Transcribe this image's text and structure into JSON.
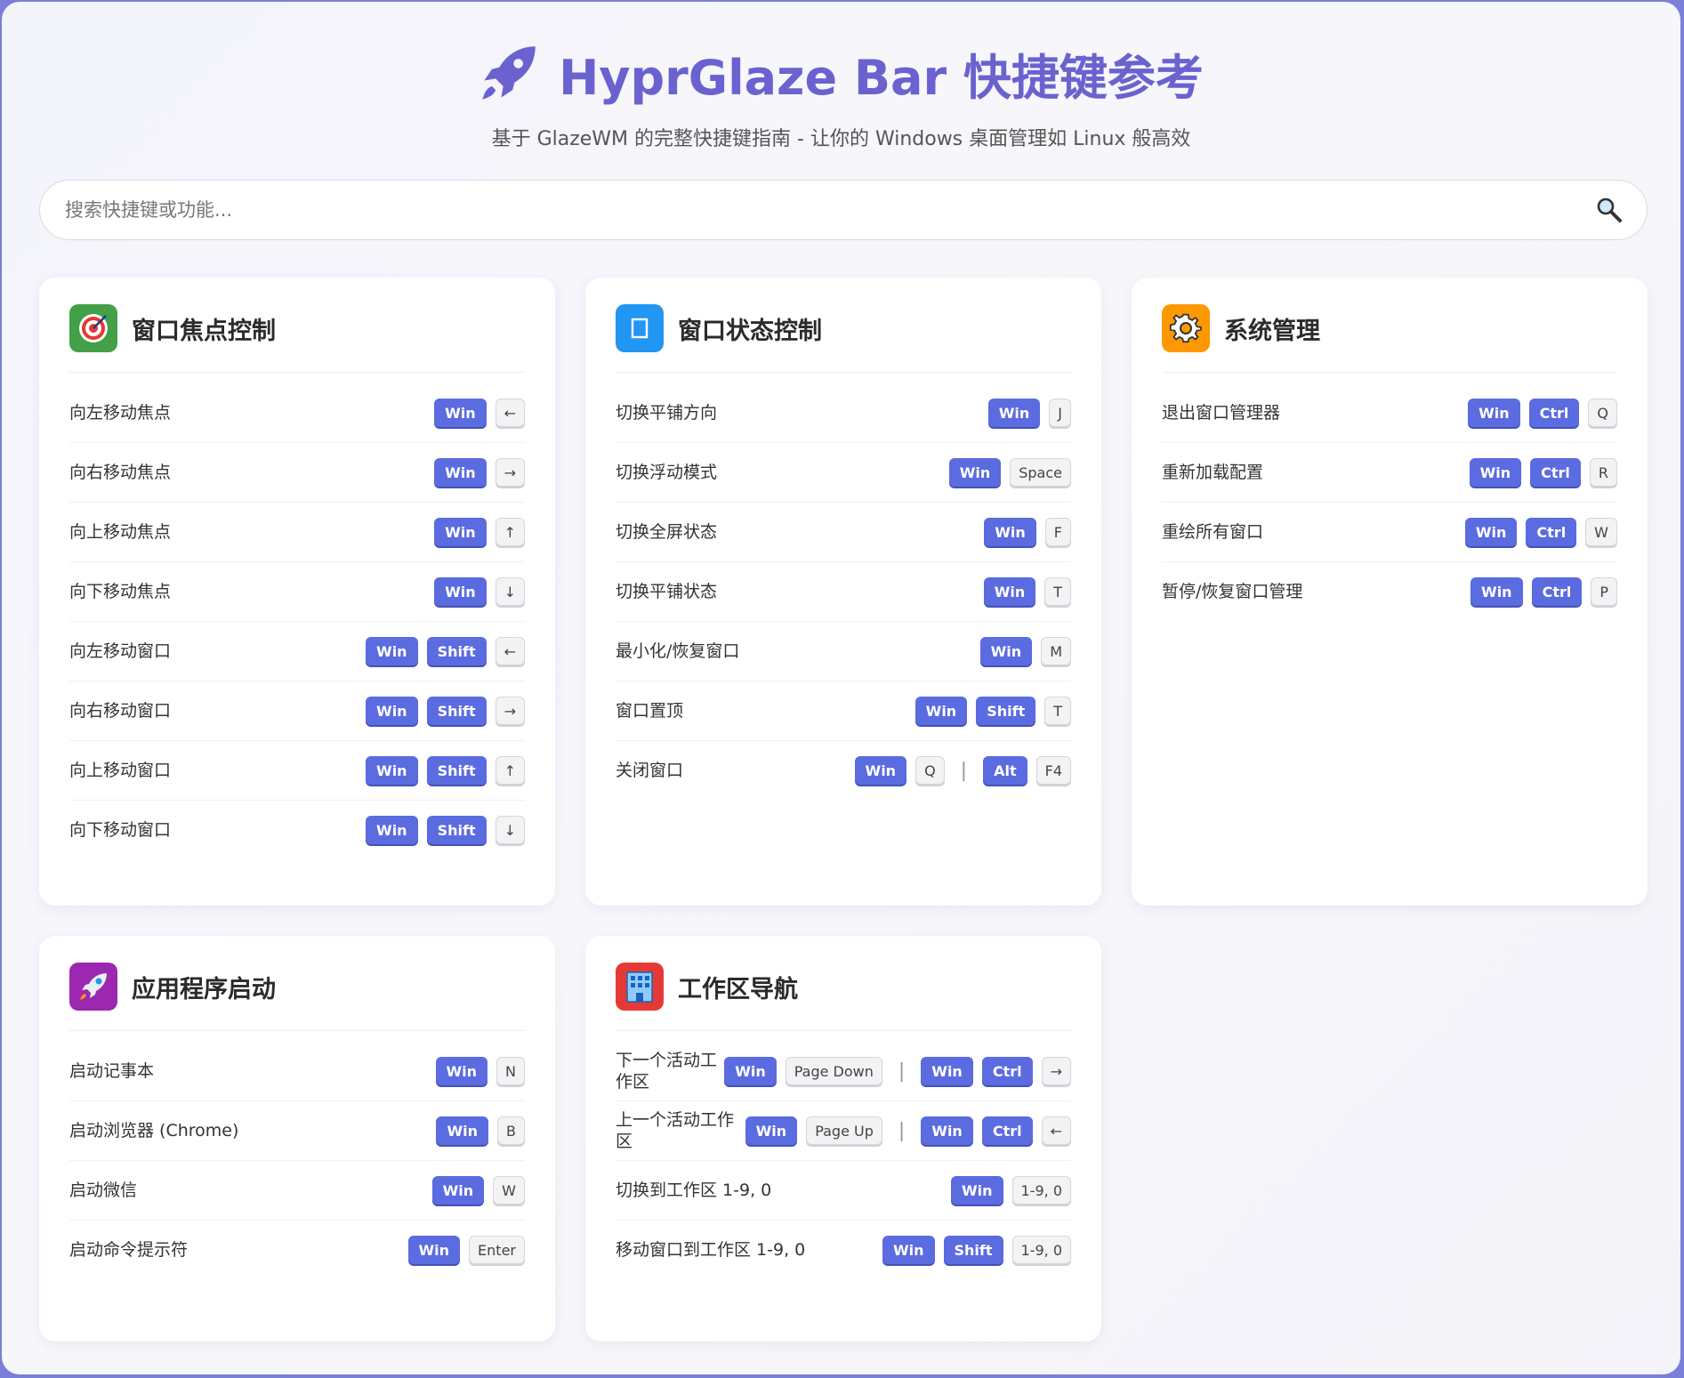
{
  "header": {
    "title": "HyprGlaze Bar 快捷键参考",
    "subtitle": "基于 GlazeWM 的完整快捷键指南 - 让你的 Windows 桌面管理如 Linux 般高效"
  },
  "search": {
    "placeholder": "搜索快捷键或功能..."
  },
  "cards": [
    {
      "title": "窗口焦点控制",
      "icon": "target-icon",
      "rows": [
        {
          "label": "向左移动焦点",
          "groups": [
            [
              {
                "k": "Win",
                "m": true
              },
              {
                "k": "←"
              }
            ]
          ]
        },
        {
          "label": "向右移动焦点",
          "groups": [
            [
              {
                "k": "Win",
                "m": true
              },
              {
                "k": "→"
              }
            ]
          ]
        },
        {
          "label": "向上移动焦点",
          "groups": [
            [
              {
                "k": "Win",
                "m": true
              },
              {
                "k": "↑"
              }
            ]
          ]
        },
        {
          "label": "向下移动焦点",
          "groups": [
            [
              {
                "k": "Win",
                "m": true
              },
              {
                "k": "↓"
              }
            ]
          ]
        },
        {
          "label": "向左移动窗口",
          "groups": [
            [
              {
                "k": "Win",
                "m": true
              },
              {
                "k": "Shift",
                "m": true
              },
              {
                "k": "←"
              }
            ]
          ]
        },
        {
          "label": "向右移动窗口",
          "groups": [
            [
              {
                "k": "Win",
                "m": true
              },
              {
                "k": "Shift",
                "m": true
              },
              {
                "k": "→"
              }
            ]
          ]
        },
        {
          "label": "向上移动窗口",
          "groups": [
            [
              {
                "k": "Win",
                "m": true
              },
              {
                "k": "Shift",
                "m": true
              },
              {
                "k": "↑"
              }
            ]
          ]
        },
        {
          "label": "向下移动窗口",
          "groups": [
            [
              {
                "k": "Win",
                "m": true
              },
              {
                "k": "Shift",
                "m": true
              },
              {
                "k": "↓"
              }
            ]
          ]
        }
      ]
    },
    {
      "title": "窗口状态控制",
      "icon": "window-icon",
      "rows": [
        {
          "label": "切换平铺方向",
          "groups": [
            [
              {
                "k": "Win",
                "m": true
              },
              {
                "k": "J"
              }
            ]
          ]
        },
        {
          "label": "切换浮动模式",
          "groups": [
            [
              {
                "k": "Win",
                "m": true
              },
              {
                "k": "Space"
              }
            ]
          ]
        },
        {
          "label": "切换全屏状态",
          "groups": [
            [
              {
                "k": "Win",
                "m": true
              },
              {
                "k": "F"
              }
            ]
          ]
        },
        {
          "label": "切换平铺状态",
          "groups": [
            [
              {
                "k": "Win",
                "m": true
              },
              {
                "k": "T"
              }
            ]
          ]
        },
        {
          "label": "最小化/恢复窗口",
          "groups": [
            [
              {
                "k": "Win",
                "m": true
              },
              {
                "k": "M"
              }
            ]
          ]
        },
        {
          "label": "窗口置顶",
          "groups": [
            [
              {
                "k": "Win",
                "m": true
              },
              {
                "k": "Shift",
                "m": true
              },
              {
                "k": "T"
              }
            ]
          ]
        },
        {
          "label": "关闭窗口",
          "groups": [
            [
              {
                "k": "Win",
                "m": true
              },
              {
                "k": "Q"
              }
            ],
            [
              {
                "k": "Alt",
                "m": true
              },
              {
                "k": "F4"
              }
            ]
          ]
        }
      ]
    },
    {
      "title": "系统管理",
      "icon": "gear-icon",
      "rows": [
        {
          "label": "退出窗口管理器",
          "groups": [
            [
              {
                "k": "Win",
                "m": true
              },
              {
                "k": "Ctrl",
                "m": true
              },
              {
                "k": "Q"
              }
            ]
          ]
        },
        {
          "label": "重新加载配置",
          "groups": [
            [
              {
                "k": "Win",
                "m": true
              },
              {
                "k": "Ctrl",
                "m": true
              },
              {
                "k": "R"
              }
            ]
          ]
        },
        {
          "label": "重绘所有窗口",
          "groups": [
            [
              {
                "k": "Win",
                "m": true
              },
              {
                "k": "Ctrl",
                "m": true
              },
              {
                "k": "W"
              }
            ]
          ]
        },
        {
          "label": "暂停/恢复窗口管理",
          "groups": [
            [
              {
                "k": "Win",
                "m": true
              },
              {
                "k": "Ctrl",
                "m": true
              },
              {
                "k": "P"
              }
            ]
          ]
        }
      ]
    },
    {
      "title": "应用程序启动",
      "icon": "rocket-icon",
      "rows": [
        {
          "label": "启动记事本",
          "groups": [
            [
              {
                "k": "Win",
                "m": true
              },
              {
                "k": "N"
              }
            ]
          ]
        },
        {
          "label": "启动浏览器 (Chrome)",
          "groups": [
            [
              {
                "k": "Win",
                "m": true
              },
              {
                "k": "B"
              }
            ]
          ]
        },
        {
          "label": "启动微信",
          "groups": [
            [
              {
                "k": "Win",
                "m": true
              },
              {
                "k": "W"
              }
            ]
          ]
        },
        {
          "label": "启动命令提示符",
          "groups": [
            [
              {
                "k": "Win",
                "m": true
              },
              {
                "k": "Enter"
              }
            ]
          ]
        }
      ]
    },
    {
      "title": "工作区导航",
      "icon": "building-icon",
      "rows": [
        {
          "label": "下一个活动工作区",
          "groups": [
            [
              {
                "k": "Win",
                "m": true
              },
              {
                "k": "Page Down"
              }
            ],
            [
              {
                "k": "Win",
                "m": true
              },
              {
                "k": "Ctrl",
                "m": true
              },
              {
                "k": "→"
              }
            ]
          ]
        },
        {
          "label": "上一个活动工作区",
          "groups": [
            [
              {
                "k": "Win",
                "m": true
              },
              {
                "k": "Page Up"
              }
            ],
            [
              {
                "k": "Win",
                "m": true
              },
              {
                "k": "Ctrl",
                "m": true
              },
              {
                "k": "←"
              }
            ]
          ]
        },
        {
          "label": "切换到工作区 1-9, 0",
          "groups": [
            [
              {
                "k": "Win",
                "m": true
              },
              {
                "k": "1-9, 0"
              }
            ]
          ]
        },
        {
          "label": "移动窗口到工作区 1-9, 0",
          "groups": [
            [
              {
                "k": "Win",
                "m": true
              },
              {
                "k": "Shift",
                "m": true
              },
              {
                "k": "1-9, 0"
              }
            ]
          ]
        }
      ]
    }
  ],
  "colors": {
    "accent": "#6a62cf",
    "modifier_key": "#5b6be0",
    "icon_green": "#43a047",
    "icon_blue": "#2196f3",
    "icon_orange": "#ff9800",
    "icon_purple": "#9c27b0",
    "icon_red": "#e53935"
  }
}
